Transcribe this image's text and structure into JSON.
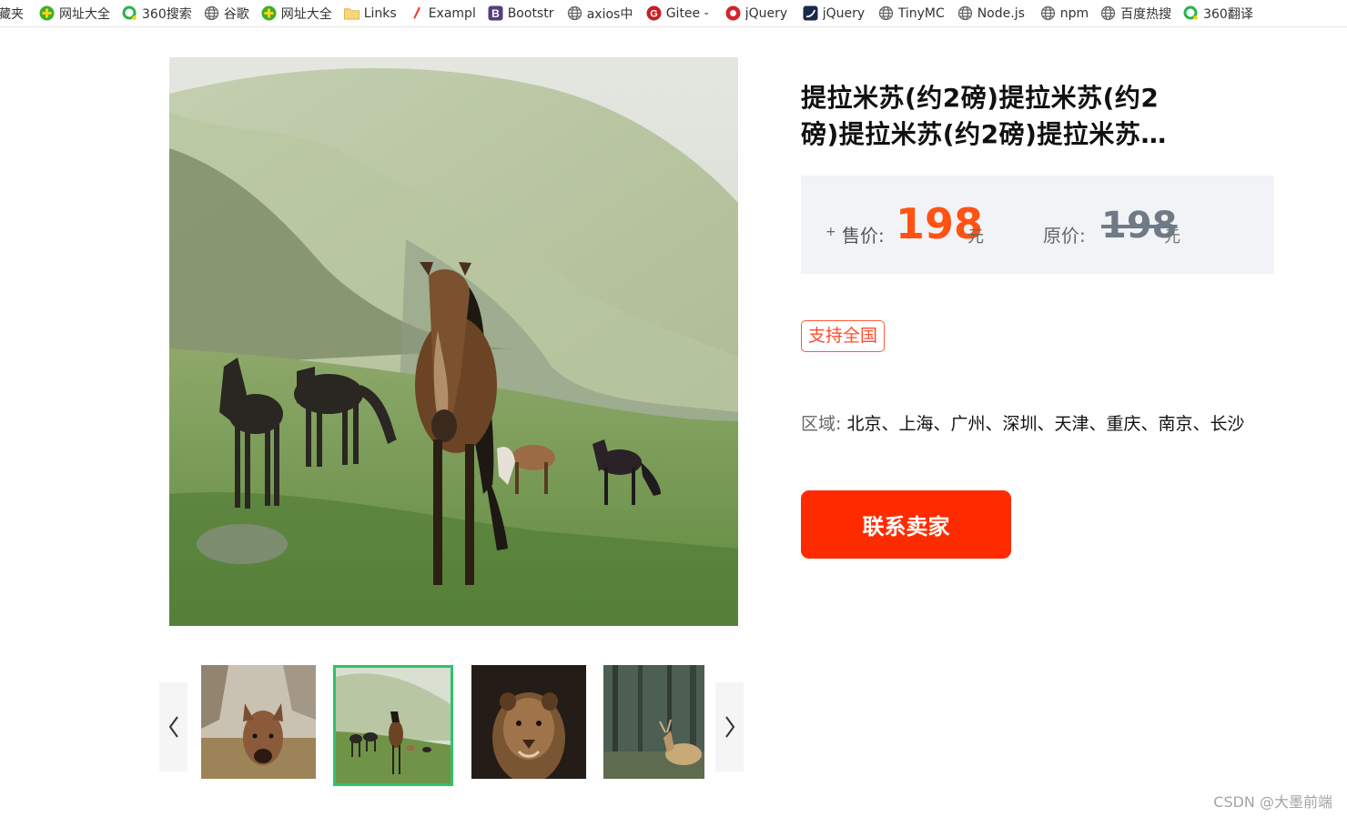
{
  "bookmarks": [
    {
      "label": "藏夹",
      "icon": "folder-icon"
    },
    {
      "label": "网址大全",
      "icon": "360-navigation-icon"
    },
    {
      "label": "360搜索",
      "icon": "360-search-icon"
    },
    {
      "label": "谷歌",
      "icon": "globe-icon"
    },
    {
      "label": "网址大全",
      "icon": "360-navigation-icon"
    },
    {
      "label": "Links",
      "icon": "folder-icon"
    },
    {
      "label": "Exampl",
      "icon": "pen-icon"
    },
    {
      "label": "Bootstr",
      "icon": "bootstrap-icon"
    },
    {
      "label": "axios中",
      "icon": "globe-icon"
    },
    {
      "label": "Gitee -",
      "icon": "gitee-icon"
    },
    {
      "label": "jQuery",
      "icon": "jquery-red-icon"
    },
    {
      "label": "jQuery",
      "icon": "jquery-dark-icon"
    },
    {
      "label": "TinyMC",
      "icon": "globe-icon"
    },
    {
      "label": "Node.js",
      "icon": "globe-icon"
    },
    {
      "label": "npm",
      "icon": "globe-icon"
    },
    {
      "label": "百度热搜",
      "icon": "globe-icon"
    },
    {
      "label": "360翻译",
      "icon": "360-search-icon"
    }
  ],
  "product": {
    "title": "提拉米苏(约2磅)提拉米苏(约2磅)提拉米苏(约2磅)提拉米苏…",
    "sale_plus": "+",
    "sale_label": "售价:",
    "sale_price": "198",
    "sale_unit": "元",
    "orig_label": "原价:",
    "orig_price": "198",
    "orig_unit": "元",
    "tag": "支持全国",
    "region_label": "区域:",
    "region_value": "北京、上海、广州、深圳、天津、重庆、南京、长沙",
    "contact_button": "联系卖家"
  },
  "gallery": {
    "selected_index": 1,
    "thumbnails": [
      "deer",
      "horses",
      "lioness",
      "resting-deer"
    ]
  },
  "watermark": "CSDN @大墨前端",
  "colors": {
    "sale_price": "#ff5214",
    "contact_button": "#ff2b00",
    "active_thumb_border": "#2ec36a",
    "tag_border": "#ff5b3a"
  }
}
